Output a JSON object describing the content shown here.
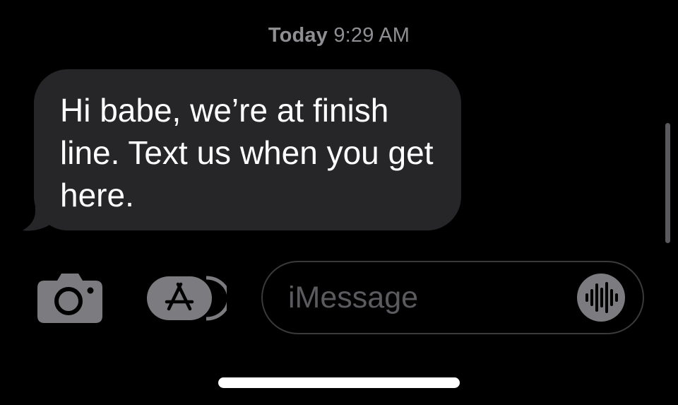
{
  "conversation": {
    "timestamp_day": "Today",
    "timestamp_time": "9:29 AM",
    "messages": [
      {
        "direction": "incoming",
        "text": "Hi babe, we’re at finish line. Text us when you get here."
      }
    ]
  },
  "composer": {
    "placeholder": "iMessage",
    "camera_icon": "camera-icon",
    "apps_icon": "app-store-icon",
    "audio_icon": "audio-waveform-icon"
  },
  "colors": {
    "background": "#000000",
    "incoming_bubble": "#262629",
    "timestamp": "#8e8e93",
    "control_gray": "#7c7c80",
    "field_border": "#3a3a3c"
  }
}
